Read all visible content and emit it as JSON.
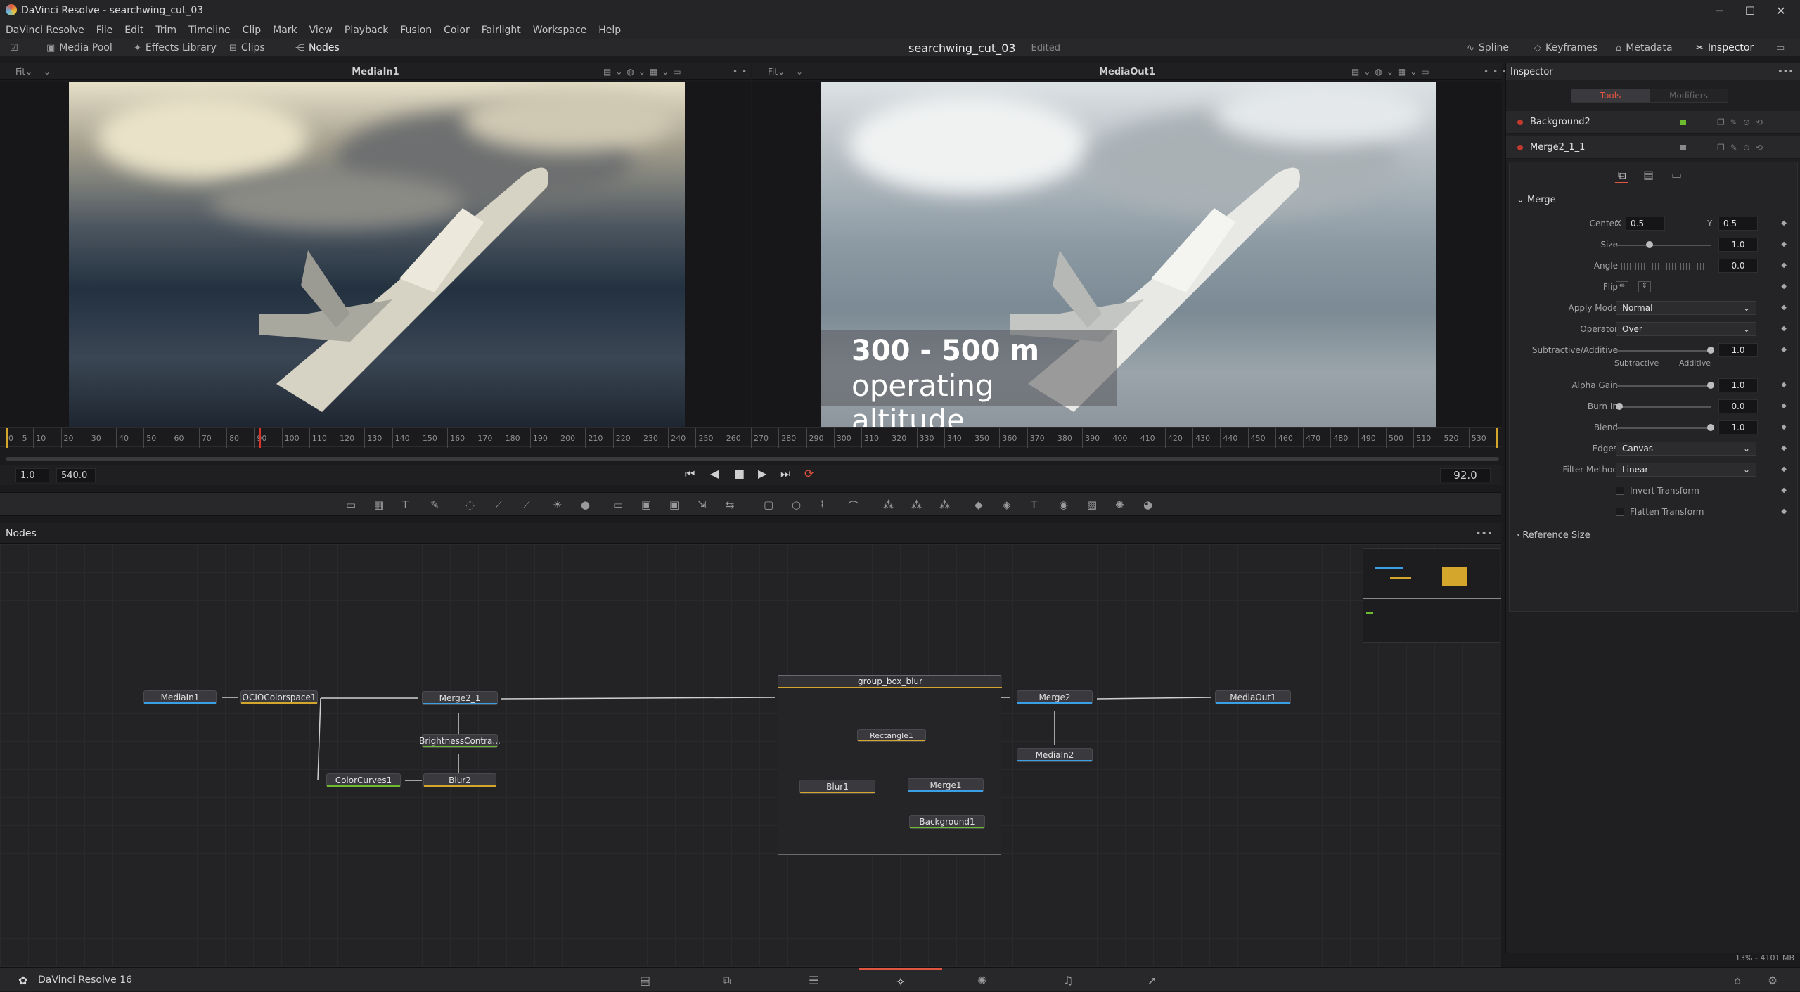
{
  "window": {
    "title": "DaVinci Resolve - searchwing_cut_03",
    "minimize": "─",
    "maximize": "☐",
    "close": "✕"
  },
  "menu": [
    "DaVinci Resolve",
    "File",
    "Edit",
    "Trim",
    "Timeline",
    "Clip",
    "Mark",
    "View",
    "Playback",
    "Fusion",
    "Color",
    "Fairlight",
    "Workspace",
    "Help"
  ],
  "toolbar": {
    "media_pool": "Media Pool",
    "effects_library": "Effects Library",
    "clips": "Clips",
    "nodes": "Nodes",
    "project_name": "searchwing_cut_03",
    "edited": "Edited",
    "spline": "Spline",
    "keyframes": "Keyframes",
    "metadata": "Metadata",
    "inspector": "Inspector"
  },
  "viewer_left": {
    "fit": "Fit",
    "title": "MediaIn1"
  },
  "viewer_right": {
    "fit": "Fit",
    "title": "MediaOut1"
  },
  "overlay": {
    "line1": "300 - 500 m",
    "line2": "operating altitude"
  },
  "ruler": {
    "ticks": [
      0,
      5,
      10,
      20,
      30,
      40,
      50,
      60,
      70,
      80,
      90,
      100,
      110,
      120,
      130,
      140,
      150,
      160,
      170,
      180,
      190,
      200,
      210,
      220,
      230,
      240,
      250,
      260,
      270,
      280,
      290,
      300,
      310,
      320,
      330,
      340,
      350,
      360,
      370,
      380,
      390,
      400,
      410,
      420,
      430,
      440,
      450,
      460,
      470,
      480,
      490,
      500,
      510,
      520,
      530
    ]
  },
  "transport": {
    "start": "1.0",
    "end": "540.0",
    "current": "92.0",
    "playhead_frame": 92
  },
  "nodes_panel": {
    "title": "Nodes",
    "more": "•••"
  },
  "nodes": {
    "mediain1": "MediaIn1",
    "ociocolorspace1": "OCIOColorspace1",
    "merge2_1": "Merge2_1",
    "brightnesscontrast": "BrightnessContra...",
    "colorcurves1": "ColorCurves1",
    "blur2": "Blur2",
    "group": "group_box_blur",
    "rectangle1": "Rectangle1",
    "blur1": "Blur1",
    "merge1": "Merge1",
    "background1": "Background1",
    "merge2": "Merge2",
    "mediain2": "MediaIn2",
    "mediaout1": "MediaOut1"
  },
  "inspector": {
    "title": "Inspector",
    "tab_tools": "Tools",
    "tab_modifiers": "Modifiers",
    "tools": [
      {
        "name": "Background2"
      },
      {
        "name": "Merge2_1_1"
      }
    ],
    "section": "Merge",
    "center": {
      "label": "Center",
      "x_label": "X",
      "x": "0.5",
      "y_label": "Y",
      "y": "0.5"
    },
    "size": {
      "label": "Size",
      "value": "1.0",
      "fraction": 0.33
    },
    "angle": {
      "label": "Angle",
      "value": "0.0"
    },
    "flip": {
      "label": "Flip"
    },
    "apply_mode": {
      "label": "Apply Mode",
      "value": "Normal"
    },
    "operator": {
      "label": "Operator",
      "value": "Over"
    },
    "subtractive_additive": {
      "label": "Subtractive/Additive",
      "value": "1.0",
      "fraction": 1.0,
      "left": "Subtractive",
      "right": "Additive"
    },
    "alpha_gain": {
      "label": "Alpha Gain",
      "value": "1.0",
      "fraction": 1.0
    },
    "burn_in": {
      "label": "Burn In",
      "value": "0.0",
      "fraction": 0.0
    },
    "blend": {
      "label": "Blend",
      "value": "1.0",
      "fraction": 1.0
    },
    "edges": {
      "label": "Edges",
      "value": "Canvas"
    },
    "filter_method": {
      "label": "Filter Method",
      "value": "Linear"
    },
    "invert_transform": "Invert Transform",
    "flatten_transform": "Flatten Transform",
    "reference_size": "Reference Size"
  },
  "status": {
    "app": "DaVinci Resolve 16",
    "memory": "13% - 4101 MB"
  },
  "colors": {
    "accent": "#e0553f",
    "node_yellow": "#d4a72c",
    "node_blue": "#3aa0e6",
    "node_green": "#6dbb2e"
  }
}
